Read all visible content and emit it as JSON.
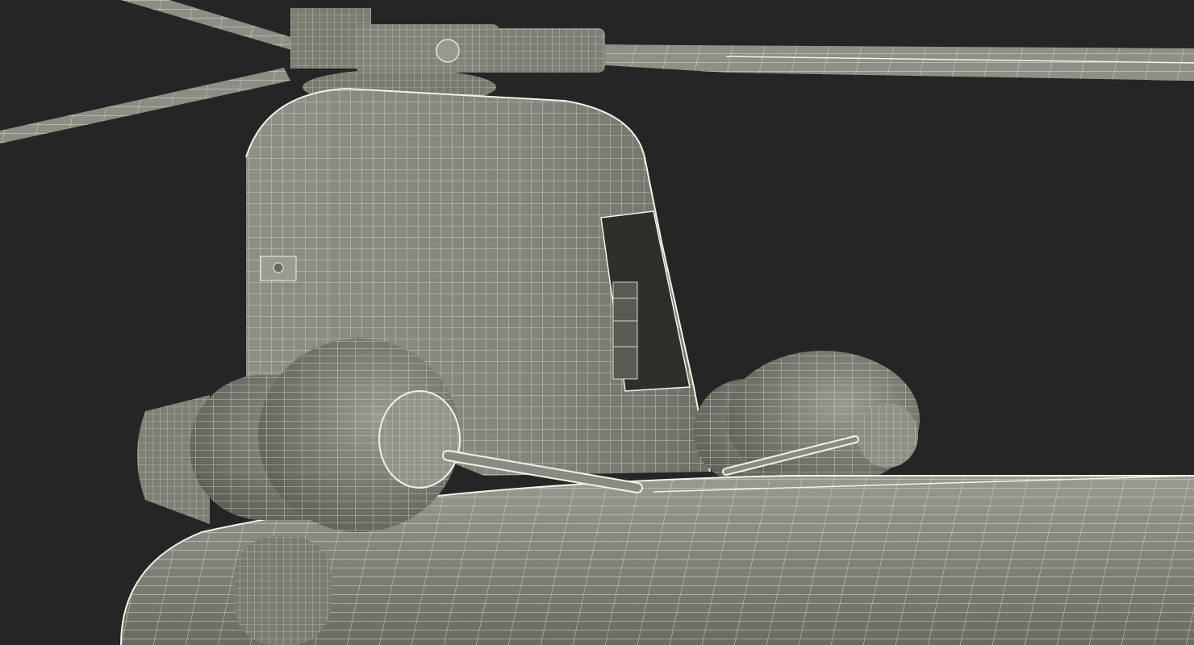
{
  "viewport": {
    "background_color": "#252525"
  },
  "render": {
    "subject": "helicopter-front-rotor-pylon",
    "style": "wireframe-over-shaded",
    "mesh_fill_color": "#8b8b80",
    "mesh_shadow_color": "#5e5e56",
    "mesh_highlight_color": "#a7a79c",
    "wire_color": "#f2f2e8"
  },
  "parts": [
    "rotor-blades",
    "rotor-hub",
    "pylon-housing",
    "engine-left",
    "engine-right",
    "fuselage-top",
    "intake-opening"
  ]
}
